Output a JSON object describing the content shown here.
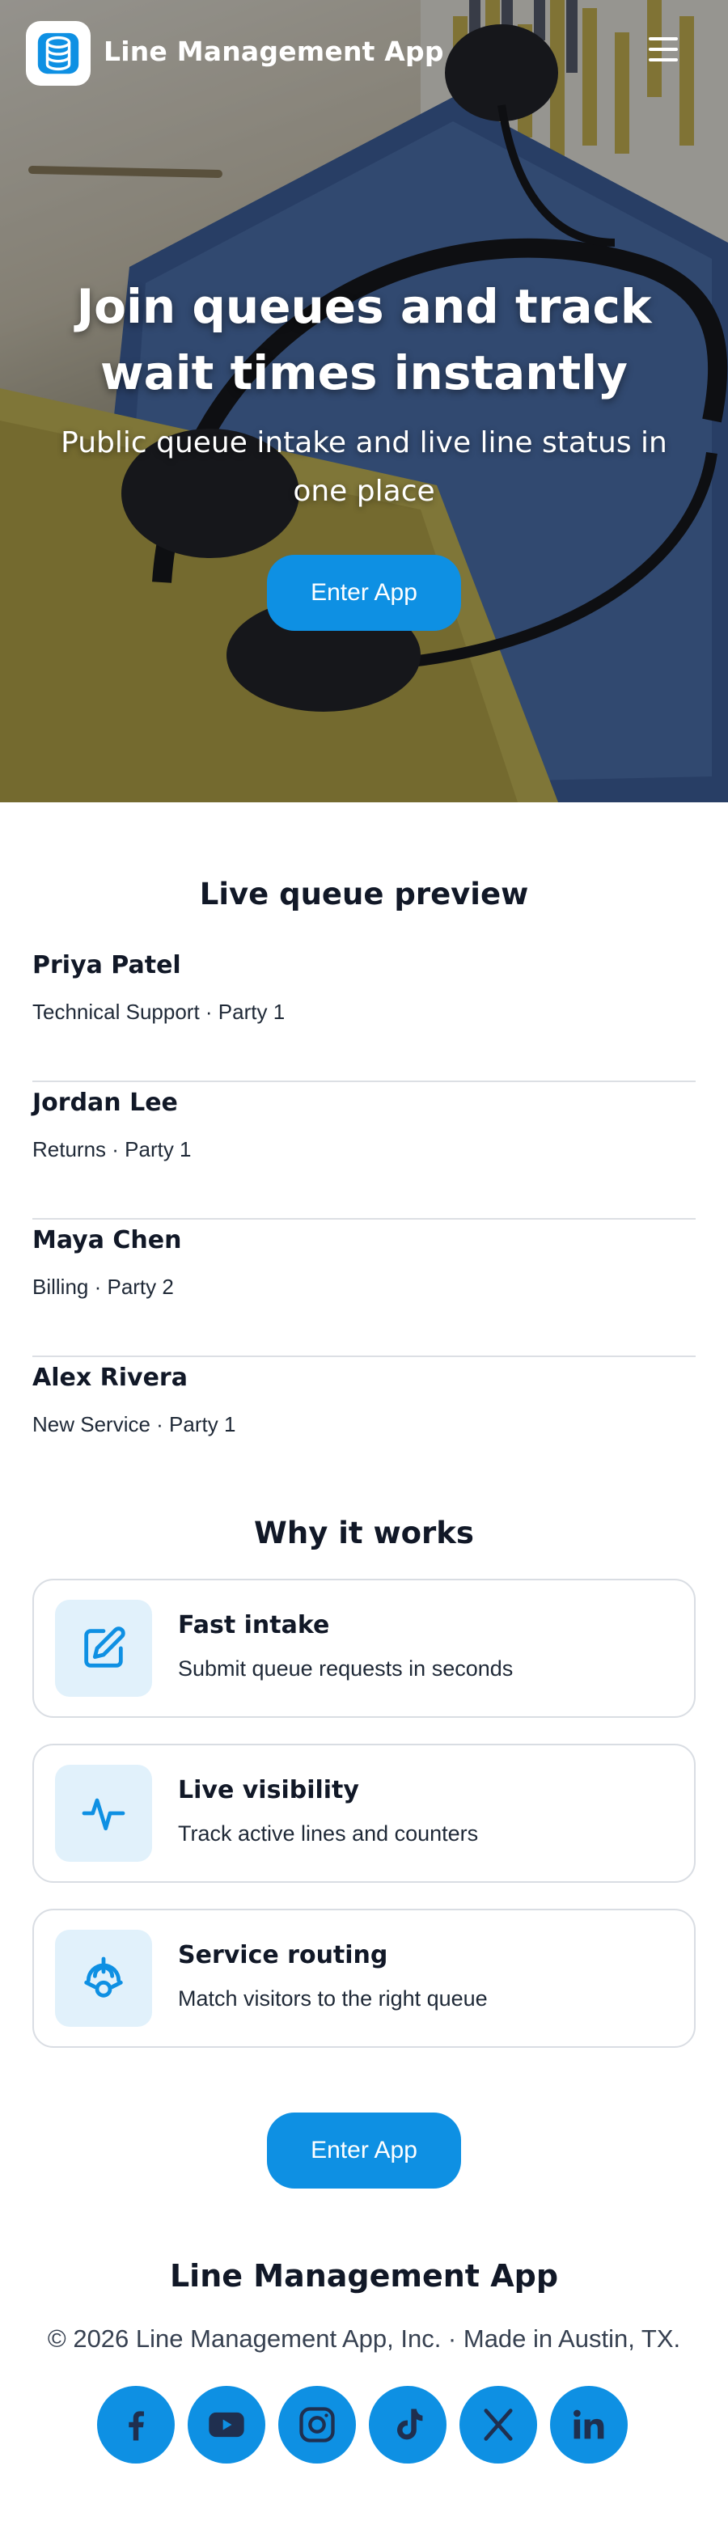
{
  "header": {
    "app_title": "Line Management App",
    "logo_icon": "database-icon",
    "menu_icon": "hamburger-menu-icon"
  },
  "hero": {
    "headline": "Join queues and track wait times instantly",
    "subheadline": "Public queue intake and live line status in one place",
    "cta_label": "Enter App"
  },
  "preview": {
    "title": "Live queue preview",
    "items": [
      {
        "name": "Priya Patel",
        "meta": "Technical Support · Party 1"
      },
      {
        "name": "Jordan Lee",
        "meta": "Returns · Party 1"
      },
      {
        "name": "Maya Chen",
        "meta": "Billing · Party 2"
      },
      {
        "name": "Alex Rivera",
        "meta": "New Service · Party 1"
      }
    ]
  },
  "features": {
    "title": "Why it works",
    "items": [
      {
        "icon": "edit-icon",
        "title": "Fast intake",
        "desc": "Submit queue requests in seconds"
      },
      {
        "icon": "activity-icon",
        "title": "Live visibility",
        "desc": "Track active lines and counters"
      },
      {
        "icon": "routing-icon",
        "title": "Service routing",
        "desc": "Match visitors to the right queue"
      }
    ]
  },
  "cta": {
    "label": "Enter App"
  },
  "footer": {
    "title": "Line Management App",
    "copyright": "© 2026 Line Management App, Inc. · Made in Austin, TX.",
    "socials": [
      "facebook-icon",
      "youtube-icon",
      "instagram-icon",
      "tiktok-icon",
      "x-icon",
      "linkedin-icon"
    ]
  },
  "colors": {
    "accent": "#0e90e3",
    "icon_tile": "#e1f1fb",
    "text": "#111827",
    "border": "#d9dde3"
  }
}
